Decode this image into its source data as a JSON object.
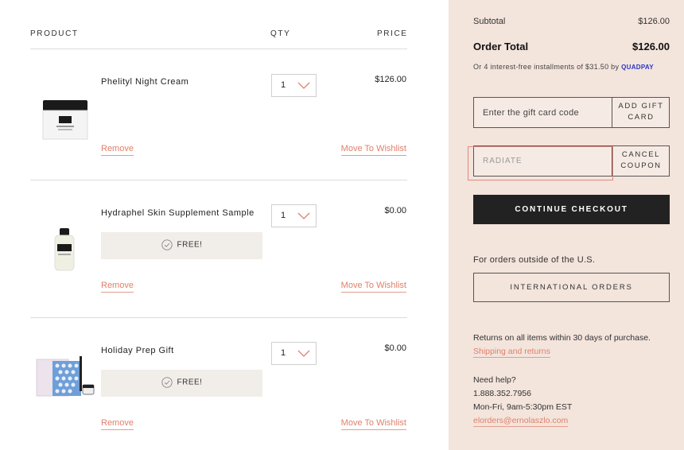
{
  "cart": {
    "headers": {
      "product": "PRODUCT",
      "qty": "QTY",
      "price": "PRICE"
    },
    "items": [
      {
        "name": "Phelityl Night Cream",
        "qty": "1",
        "price": "$126.00",
        "free": null,
        "remove": "Remove",
        "wishlist": "Move To Wishlist",
        "icon": "night-cream-jar-icon"
      },
      {
        "name": "Hydraphel Skin Supplement Sample",
        "qty": "1",
        "price": "$0.00",
        "free": "FREE!",
        "remove": "Remove",
        "wishlist": "Move To Wishlist",
        "icon": "supplement-bottle-icon"
      },
      {
        "name": "Holiday Prep Gift",
        "qty": "1",
        "price": "$0.00",
        "free": "FREE!",
        "remove": "Remove",
        "wishlist": "Move To Wishlist",
        "icon": "gift-set-icon"
      }
    ]
  },
  "summary": {
    "subtotal_label": "Subtotal",
    "subtotal_value": "$126.00",
    "total_label": "Order Total",
    "total_value": "$126.00",
    "installments_text": "Or 4 interest-free installments of $31.50 by",
    "installments_brand": "QUADPAY",
    "gift_placeholder": "Enter the gift card code",
    "gift_button": "ADD GIFT CARD",
    "coupon_value": "RADIATE",
    "coupon_button": "CANCEL COUPON",
    "checkout_button": "CONTINUE CHECKOUT",
    "outside_text": "For orders outside of the U.S.",
    "intl_button": "INTERNATIONAL ORDERS",
    "returns_text": "Returns on all items within 30 days of purchase.",
    "shipping_link": "Shipping and returns",
    "help_label": "Need help?",
    "phone": "1.888.352.7956",
    "hours": "Mon-Fri, 9am-5:30pm EST",
    "email": "elorders@ernolaszlo.com"
  },
  "colors": {
    "accent": "#e0806a",
    "summary_bg": "#f3e4dc",
    "checkout_bg": "#222222",
    "free_bg": "#f1ede9"
  }
}
